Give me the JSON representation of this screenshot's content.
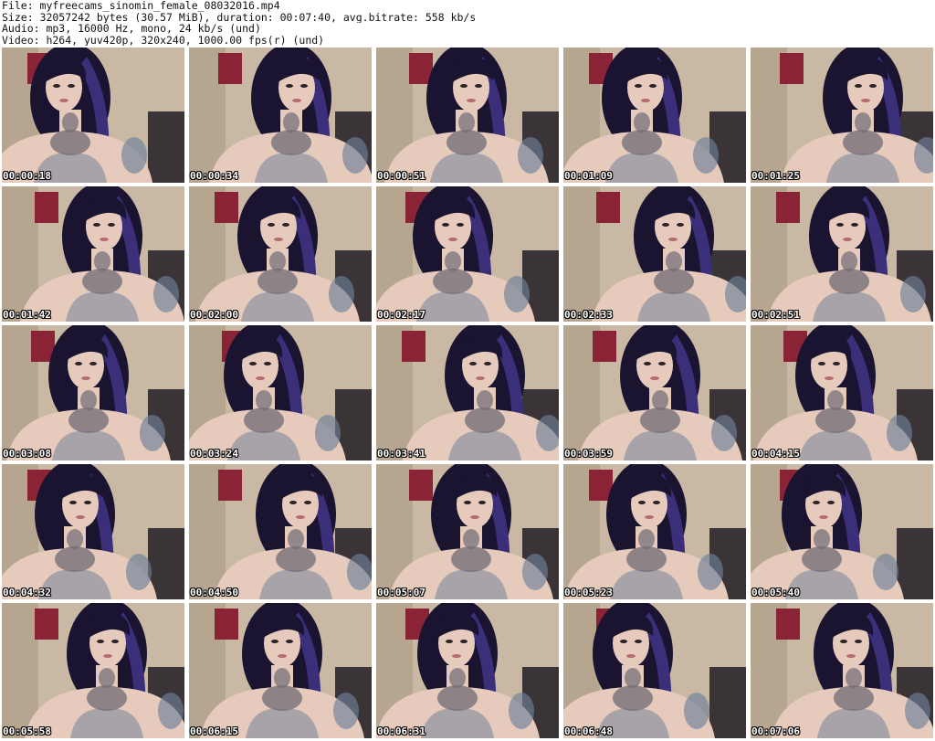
{
  "header": {
    "file_line": "File: myfreecams_sinomin_female_08032016.mp4",
    "size_line": "Size: 32057242 bytes (30.57 MiB), duration: 00:07:40, avg.bitrate: 558 kb/s",
    "audio_line": "Audio: mp3, 16000 Hz, mono, 24 kb/s (und)",
    "video_line": "Video: h264, yuv420p, 320x240, 1000.00 fps(r) (und)"
  },
  "colors": {
    "wall": "#c9b9a4",
    "poster": "#8a2335",
    "hair": "#1a1430",
    "hair_highlight": "#3b2f7a",
    "skin": "#e6cbbd",
    "tattoo": "#6f6a74",
    "top": "#a8a3a8"
  },
  "frames": [
    {
      "timestamp": "00:00:18"
    },
    {
      "timestamp": "00:00:34"
    },
    {
      "timestamp": "00:00:51"
    },
    {
      "timestamp": "00:01:09"
    },
    {
      "timestamp": "00:01:25"
    },
    {
      "timestamp": "00:01:42"
    },
    {
      "timestamp": "00:02:00"
    },
    {
      "timestamp": "00:02:17"
    },
    {
      "timestamp": "00:02:33"
    },
    {
      "timestamp": "00:02:51"
    },
    {
      "timestamp": "00:03:08"
    },
    {
      "timestamp": "00:03:24"
    },
    {
      "timestamp": "00:03:41"
    },
    {
      "timestamp": "00:03:59"
    },
    {
      "timestamp": "00:04:15"
    },
    {
      "timestamp": "00:04:32"
    },
    {
      "timestamp": "00:04:50"
    },
    {
      "timestamp": "00:05:07"
    },
    {
      "timestamp": "00:05:23"
    },
    {
      "timestamp": "00:05:40"
    },
    {
      "timestamp": "00:05:58"
    },
    {
      "timestamp": "00:06:15"
    },
    {
      "timestamp": "00:06:31"
    },
    {
      "timestamp": "00:06:48"
    },
    {
      "timestamp": "00:07:06"
    }
  ]
}
